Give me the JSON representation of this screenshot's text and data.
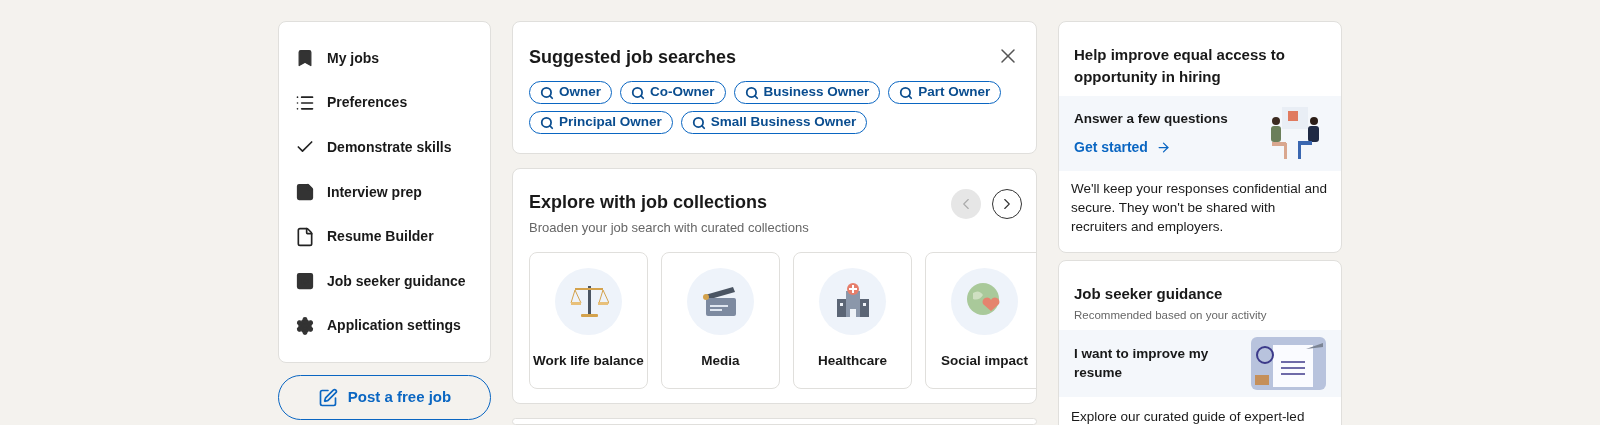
{
  "sidebar": {
    "items": [
      {
        "label": "My jobs"
      },
      {
        "label": "Preferences"
      },
      {
        "label": "Demonstrate skills"
      },
      {
        "label": "Interview prep"
      },
      {
        "label": "Resume Builder"
      },
      {
        "label": "Job seeker guidance"
      },
      {
        "label": "Application settings"
      }
    ],
    "post_button": "Post a free job"
  },
  "suggested_searches": {
    "title": "Suggested job searches",
    "chips": [
      "Owner",
      "Co-Owner",
      "Business Owner",
      "Part Owner",
      "Principal Owner",
      "Small Business Owner"
    ]
  },
  "collections": {
    "title": "Explore with job collections",
    "subtitle": "Broaden your job search with curated collections",
    "prev_disabled": true,
    "next_disabled": false,
    "items": [
      {
        "label": "Work life balance"
      },
      {
        "label": "Media"
      },
      {
        "label": "Healthcare"
      },
      {
        "label": "Social impact"
      }
    ]
  },
  "equal_access": {
    "title": "Help improve equal access to opportunity in hiring",
    "prompt": "Answer a few questions",
    "link": "Get started",
    "note": "We'll keep your responses confidential and secure. They won't be shared with recruiters and employers."
  },
  "guidance": {
    "title": "Job seeker guidance",
    "subtitle": "Recommended based on your activity",
    "prompt": "I want to improve my resume",
    "text": "Explore our curated guide of expert-led"
  }
}
